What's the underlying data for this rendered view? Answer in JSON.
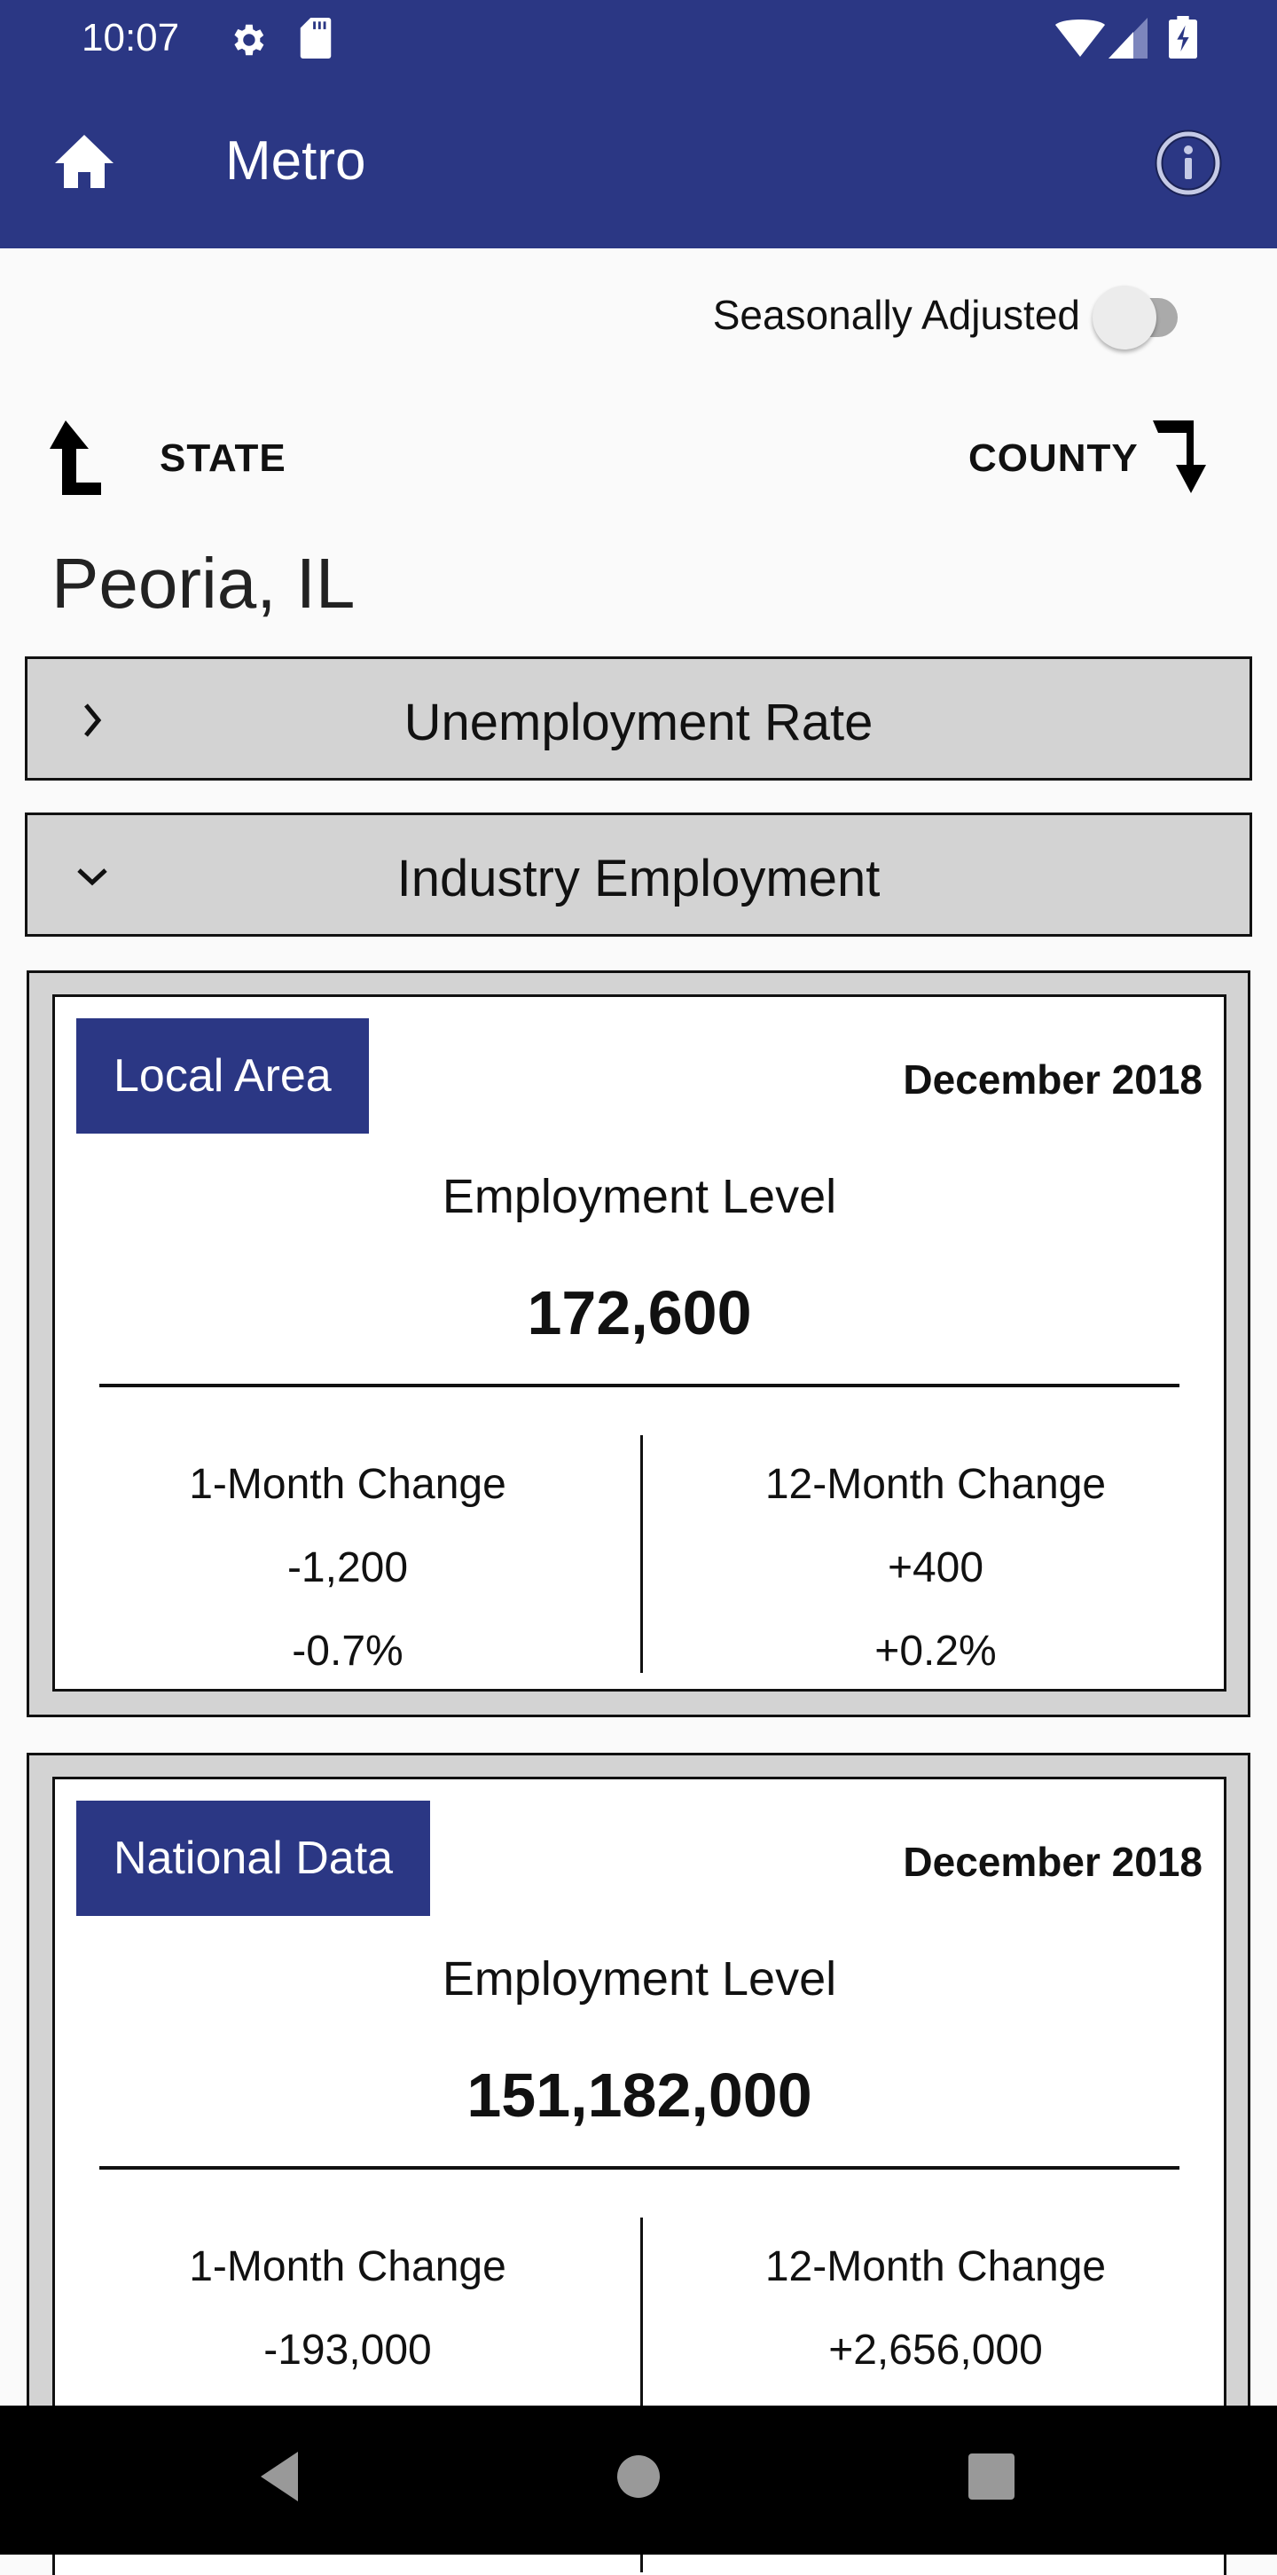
{
  "status_bar": {
    "time": "10:07",
    "left_icons": [
      "settings-icon",
      "sd-card-icon"
    ],
    "right_icons": [
      "wifi-icon",
      "cell-signal-icon",
      "battery-charging-icon"
    ]
  },
  "app_bar": {
    "title": "Metro",
    "home_icon": "home-icon",
    "info_icon": "info-icon",
    "color": "#2b3784"
  },
  "toggle": {
    "label": "Seasonally Adjusted",
    "on": false
  },
  "navigation": {
    "up_label": "STATE",
    "down_label": "COUNTY"
  },
  "place": "Peoria, IL",
  "sections": [
    {
      "title": "Unemployment Rate",
      "expanded": false
    },
    {
      "title": "Industry Employment",
      "expanded": true
    }
  ],
  "cards": [
    {
      "tag": "Local Area",
      "date": "December 2018",
      "metric": "Employment Level",
      "value": "172,600",
      "one_month": {
        "label": "1-Month Change",
        "value": "-1,200",
        "percent": "-0.7%"
      },
      "twelve_month": {
        "label": "12-Month Change",
        "value": "+400",
        "percent": "+0.2%"
      }
    },
    {
      "tag": "National Data",
      "date": "December 2018",
      "metric": "Employment Level",
      "value": "151,182,000",
      "one_month": {
        "label": "1-Month Change",
        "value": "-193,000"
      },
      "twelve_month": {
        "label": "12-Month Change",
        "value": "+2,656,000"
      }
    }
  ],
  "system_nav": [
    "back-icon",
    "home-circle-icon",
    "recents-icon"
  ]
}
